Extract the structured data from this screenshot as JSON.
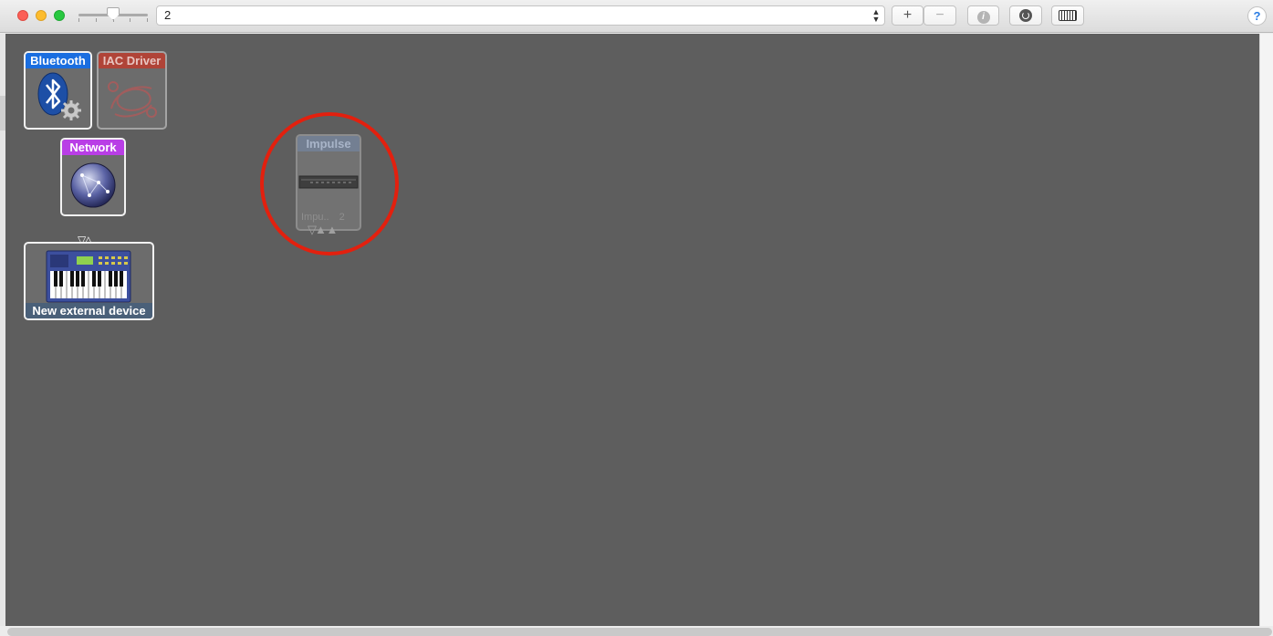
{
  "toolbar": {
    "configuration_value": "2",
    "add_label": "+",
    "remove_label": "−",
    "info_label": "i",
    "help_label": "?"
  },
  "devices": {
    "bluetooth": {
      "label": "Bluetooth"
    },
    "iac": {
      "label": "IAC Driver"
    },
    "network": {
      "label": "Network"
    },
    "external": {
      "label": "New external device"
    },
    "impulse": {
      "label": "Impulse",
      "port_label_1": "Impu..",
      "port_label_2": "2"
    }
  },
  "colors": {
    "canvas": "#5e5e5e",
    "bluetooth": "#1a6ee0",
    "iac": "#b04438",
    "network": "#b93ee6",
    "external": "#4a6079",
    "highlight": "#e3200e"
  },
  "icons": [
    "slider-knob-icon",
    "select-arrows-icon",
    "info-icon",
    "rescan-icon",
    "keyboard-icon",
    "help-icon",
    "bluetooth-icon",
    "gear-icon",
    "iac-cable-icon",
    "network-globe-icon",
    "midi-keyboard-icon",
    "impulse-device-icon",
    "port-triangle-icon"
  ]
}
